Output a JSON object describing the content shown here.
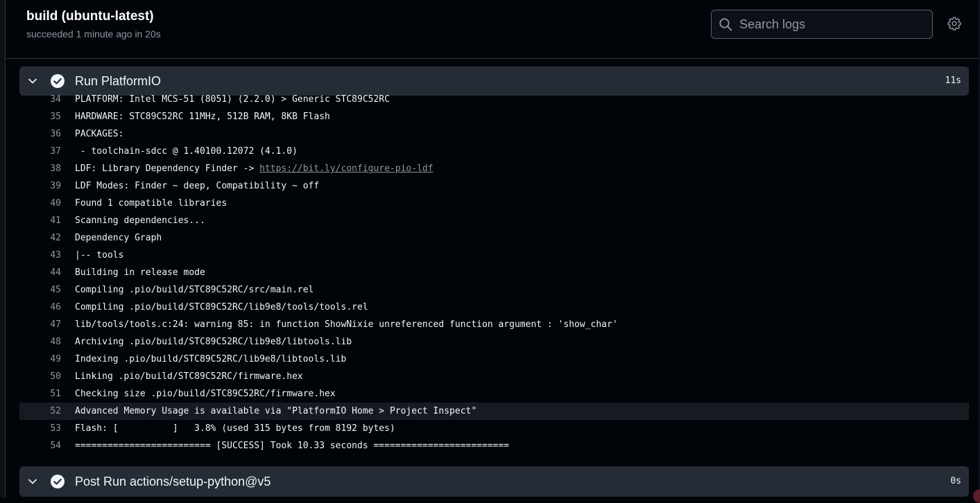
{
  "job": {
    "title": "build (ubuntu-latest)",
    "status": "succeeded 1 minute ago in 20s"
  },
  "search": {
    "placeholder": "Search logs",
    "icon": "search-icon"
  },
  "settings": {
    "icon": "gear-icon"
  },
  "steps": [
    {
      "name": "Run PlatformIO",
      "duration": "11s",
      "status": "success",
      "expanded": true,
      "lines": [
        {
          "n": "34",
          "text": "PLATFORM: Intel MCS-51 (8051) (2.2.0) > Generic STC89C52RC"
        },
        {
          "n": "35",
          "text": "HARDWARE: STC89C52RC 11MHz, 512B RAM, 8KB Flash"
        },
        {
          "n": "36",
          "text": "PACKAGES:"
        },
        {
          "n": "37",
          "text": " - toolchain-sdcc @ 1.40100.12072 (4.1.0)"
        },
        {
          "n": "38",
          "text": "LDF: Library Dependency Finder -> ",
          "link": "https://bit.ly/configure-pio-ldf"
        },
        {
          "n": "39",
          "text": "LDF Modes: Finder ~ deep, Compatibility ~ off"
        },
        {
          "n": "40",
          "text": "Found 1 compatible libraries"
        },
        {
          "n": "41",
          "text": "Scanning dependencies..."
        },
        {
          "n": "42",
          "text": "Dependency Graph"
        },
        {
          "n": "43",
          "text": "|-- tools"
        },
        {
          "n": "44",
          "text": "Building in release mode"
        },
        {
          "n": "45",
          "text": "Compiling .pio/build/STC89C52RC/src/main.rel"
        },
        {
          "n": "46",
          "text": "Compiling .pio/build/STC89C52RC/lib9e8/tools/tools.rel"
        },
        {
          "n": "47",
          "text": "lib/tools/tools.c:24: warning 85: in function ShowNixie unreferenced function argument : 'show_char'"
        },
        {
          "n": "48",
          "text": "Archiving .pio/build/STC89C52RC/lib9e8/libtools.lib"
        },
        {
          "n": "49",
          "text": "Indexing .pio/build/STC89C52RC/lib9e8/libtools.lib"
        },
        {
          "n": "50",
          "text": "Linking .pio/build/STC89C52RC/firmware.hex"
        },
        {
          "n": "51",
          "text": "Checking size .pio/build/STC89C52RC/firmware.hex"
        },
        {
          "n": "52",
          "text": "Advanced Memory Usage is available via \"PlatformIO Home > Project Inspect\"",
          "highlighted": true
        },
        {
          "n": "53",
          "text": "Flash: [          ]   3.8% (used 315 bytes from 8192 bytes)"
        },
        {
          "n": "54",
          "text": "========================= [SUCCESS] Took 10.33 seconds ========================="
        }
      ]
    },
    {
      "name": "Post Run actions/setup-python@v5",
      "duration": "0s",
      "status": "success",
      "expanded": false
    }
  ],
  "colors": {
    "background": "#010409",
    "step_header": "#262c36",
    "text": "#f0f6fc",
    "muted": "#9198a1",
    "highlight_row": "#161b22"
  }
}
